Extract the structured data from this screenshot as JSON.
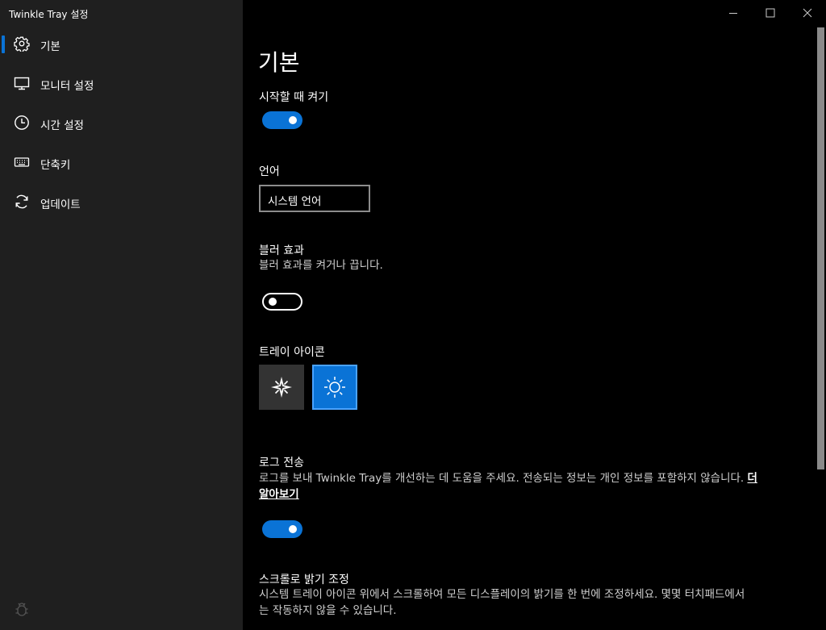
{
  "window": {
    "title": "Twinkle Tray 설정",
    "controls": {
      "minimize_icon": "minimize-icon",
      "maximize_icon": "maximize-icon",
      "close_icon": "close-icon"
    }
  },
  "sidebar": {
    "items": [
      {
        "label": "기본",
        "icon": "gear-icon",
        "selected": true
      },
      {
        "label": "모니터 설정",
        "icon": "monitor-icon",
        "selected": false
      },
      {
        "label": "시간 설정",
        "icon": "clock-icon",
        "selected": false
      },
      {
        "label": "단축키",
        "icon": "keyboard-icon",
        "selected": false
      },
      {
        "label": "업데이트",
        "icon": "refresh-icon",
        "selected": false
      }
    ],
    "footer_icon": "bug-icon"
  },
  "main": {
    "page_title": "기본",
    "startup": {
      "title": "시작할 때 켜기",
      "enabled": true
    },
    "language": {
      "title": "언어",
      "value": "시스템 언어"
    },
    "blur": {
      "title": "블러 효과",
      "desc": "블러 효과를 켜거나 끕니다.",
      "enabled": false
    },
    "tray_icon": {
      "title": "트레이 아이콘",
      "options": [
        "sparkle-icon",
        "sun-icon"
      ],
      "selected_index": 1
    },
    "logging": {
      "title": "로그 전송",
      "desc_line1": "로그를 보내 Twinkle Tray를 개선하는 데 도움을 주세요. 전송되는 정보는 개인 정보를 포함하지 않습니다.",
      "link_part1": "더",
      "link_part2": "알아보기",
      "enabled": true
    },
    "scroll": {
      "title": "스크롤로 밝기 조정",
      "desc_line1": "시스템 트레이 아이콘 위에서 스크롤하여 모든 디스플레이의 밝기를 한 번에 조정하세요. 몇몇 터치패드에서",
      "desc_line2": "는 작동하지 않을 수 있습니다."
    }
  },
  "colors": {
    "accent": "#0a73d6",
    "sidebar_bg": "#1f1f1f",
    "content_bg": "#000000"
  }
}
